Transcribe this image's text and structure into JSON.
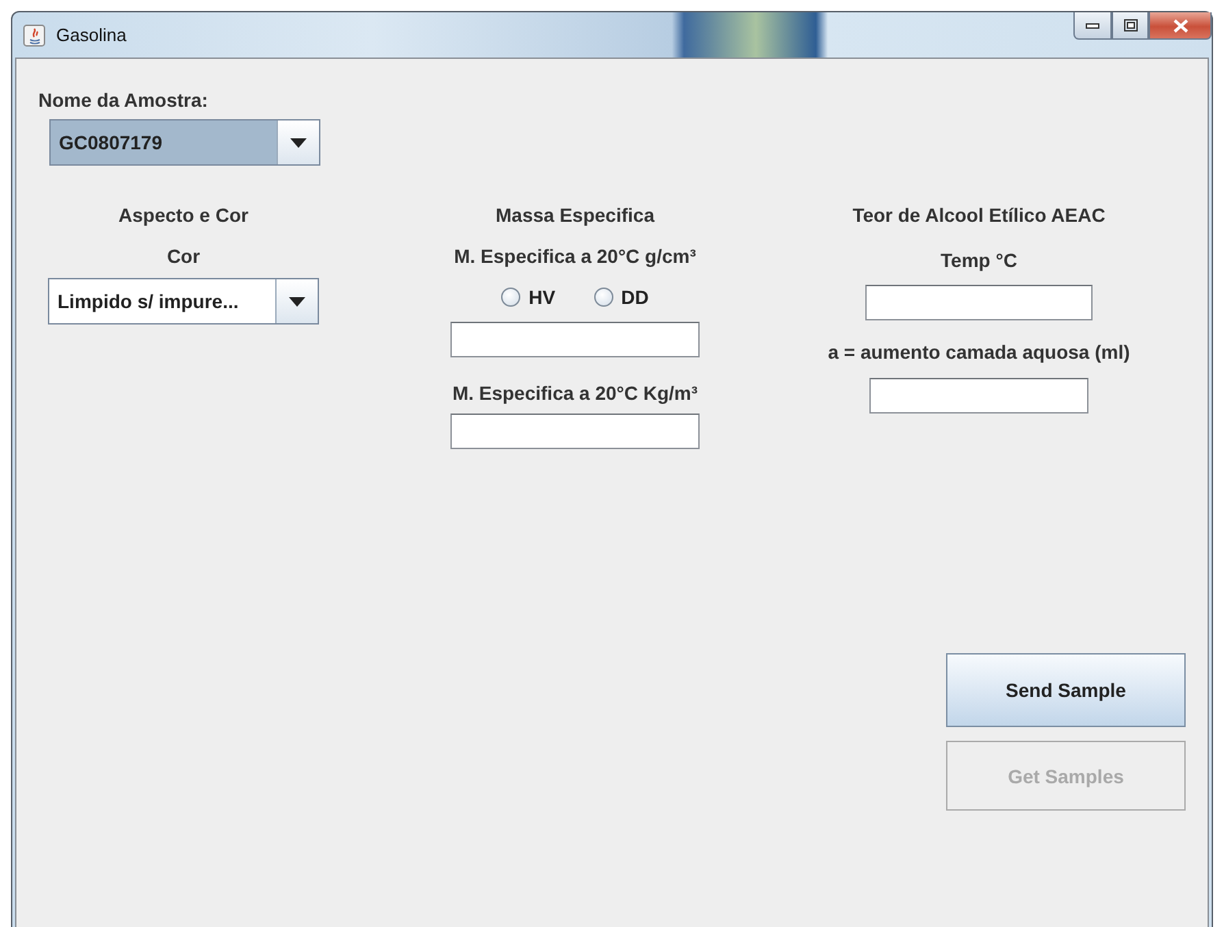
{
  "window": {
    "title": "Gasolina"
  },
  "sample_name": {
    "label": "Nome da Amostra:",
    "value": "GC0807179",
    "focused": true
  },
  "aspect": {
    "heading": "Aspecto e Cor",
    "label": "Cor",
    "value": "Limpido s/ impure...",
    "focused": false
  },
  "density": {
    "heading": "Massa Especifica",
    "label_gcm3": "M. Especifica a 20°C g/cm³",
    "options": [
      {
        "label": "HV",
        "selected": false
      },
      {
        "label": "DD",
        "selected": false
      }
    ],
    "label_kgm3": "M. Especifica a 20°C Kg/m³"
  },
  "alcohol": {
    "heading": "Teor de Alcool Etílico AEAC",
    "temp_label": "Temp °C",
    "increase_label": "a = aumento camada aquosa (ml)"
  },
  "buttons": [
    {
      "label": "Send Sample",
      "disabled": false
    },
    {
      "label": "Get Samples",
      "disabled": true
    }
  ]
}
